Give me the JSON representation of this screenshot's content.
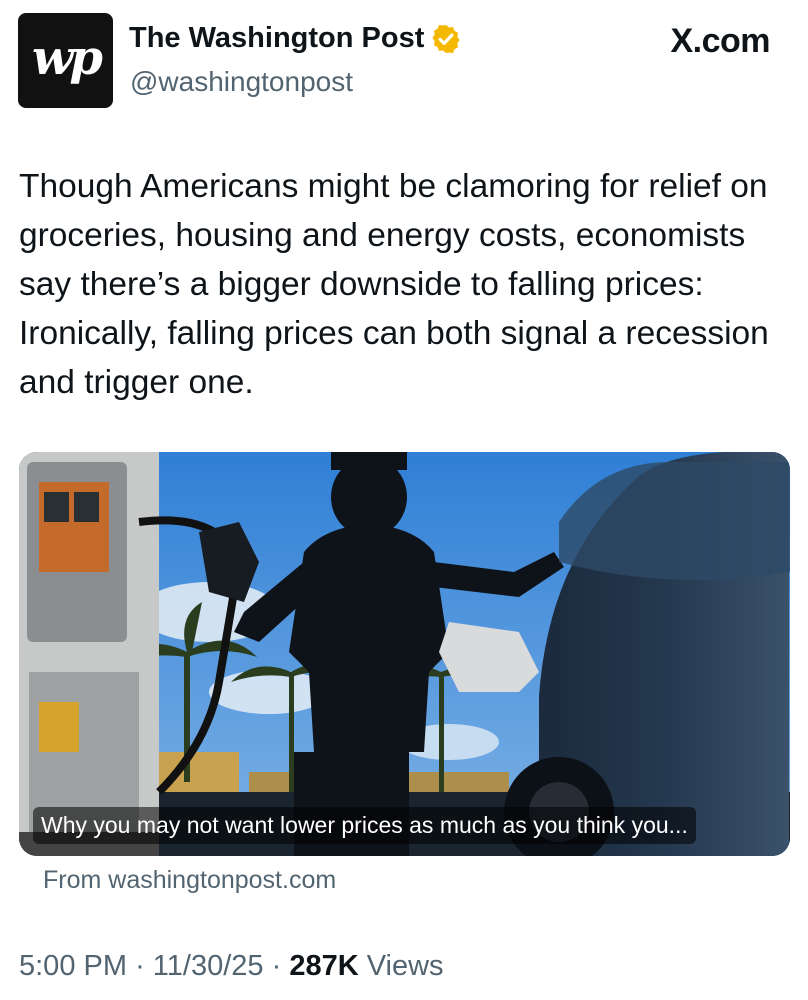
{
  "header": {
    "avatar_text": "wp",
    "display_name": "The Washington Post",
    "handle": "@washingtonpost",
    "source": "X.com",
    "verified_icon": "verified-badge-icon",
    "verified_color": "#f5b800"
  },
  "tweet": {
    "text": "Though Americans might be clamoring for relief on groceries, housing and energy costs, economists say there’s a bigger downside to falling prices: Ironically, falling prices can both signal a recession and trigger one."
  },
  "card": {
    "caption": "Why you may not want lower prices as much as you think you...",
    "from": "From washingtonpost.com"
  },
  "meta": {
    "time": "5:00 PM",
    "separator": "·",
    "date": "11/30/25",
    "views_count": "287K",
    "views_label": "Views"
  },
  "colors": {
    "text_primary": "#0f1419",
    "text_secondary": "#536471",
    "sky": "#3f86d8"
  }
}
